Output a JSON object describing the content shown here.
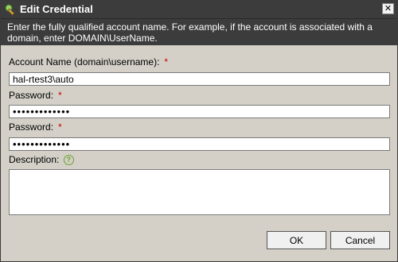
{
  "window": {
    "title": "Edit Credential",
    "close_glyph": "✕"
  },
  "header": {
    "note": "Enter the fully qualified account name.  For example, if the account is associated with a domain, enter DOMAIN\\UserName."
  },
  "form": {
    "account_label": "Account Name (domain\\username):",
    "account_value": "hal-rtest3\\auto",
    "password_label": "Password:",
    "password_value": "•••••••••••••",
    "confirm_label": "Password:",
    "confirm_value": "•••••••••••••",
    "description_label": "Description:",
    "description_value": "",
    "required_marker": "*",
    "help_glyph": "?"
  },
  "buttons": {
    "ok": "OK",
    "cancel": "Cancel"
  }
}
